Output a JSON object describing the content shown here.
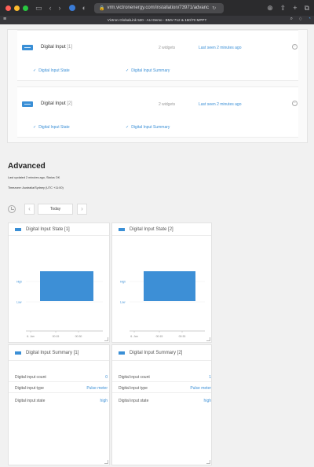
{
  "browser": {
    "url": "vrm.victronenergy.com/installation/73971/advanc",
    "lock_icon": "lock-icon"
  },
  "header": {
    "title": "Victron GlobalLink 520 - AU Demo - BMV-712 & 150/70 MPPT"
  },
  "devices": [
    {
      "name": "Digital Input",
      "index": "[1]",
      "widgets": "2 widgets",
      "last_seen": "Last seen 2 minutes ago",
      "items": [
        "Digital Input State",
        "Digital Input Summary"
      ]
    },
    {
      "name": "Digital Input",
      "index": "[2]",
      "widgets": "2 widgets",
      "last_seen": "Last seen 2 minutes ago",
      "items": [
        "Digital Input State",
        "Digital Input Summary"
      ]
    }
  ],
  "advanced": {
    "title": "Advanced",
    "updated": "Last updated 2 minutes ago, Status OK",
    "timezone": "Timezone: Australia/Sydney (UTC +11:00)",
    "today_label": "Today",
    "prev_label": "‹",
    "next_label": "›"
  },
  "state_widgets": [
    {
      "title": "Digital Input State [1]"
    },
    {
      "title": "Digital Input State [2]"
    }
  ],
  "summary_widgets": [
    {
      "title": "Digital Input Summary [1]",
      "rows": [
        {
          "label": "Digital input count",
          "value": "0"
        },
        {
          "label": "Digital input type",
          "value": "Pulse meter"
        },
        {
          "label": "Digital input state",
          "value": "high"
        }
      ]
    },
    {
      "title": "Digital Input Summary [2]",
      "rows": [
        {
          "label": "Digital input count",
          "value": "1"
        },
        {
          "label": "Digital input type",
          "value": "Pulse meter"
        },
        {
          "label": "Digital input state",
          "value": "high"
        }
      ]
    }
  ],
  "chart_data": [
    {
      "type": "area",
      "yticks": [
        "High",
        "Low"
      ],
      "xticks": [
        "6. Jan",
        "00:15",
        "00:30"
      ],
      "series": [
        {
          "values": [
            1,
            1,
            1
          ]
        }
      ],
      "bar_color": "#3d8fd6"
    },
    {
      "type": "area",
      "yticks": [
        "High",
        "Low"
      ],
      "xticks": [
        "6. Jan",
        "00:15",
        "00:30"
      ],
      "series": [
        {
          "values": [
            1,
            1,
            1
          ]
        }
      ],
      "bar_color": "#3d8fd6"
    }
  ],
  "colors": {
    "accent": "#3a8fd6",
    "header_bg": "#36363a"
  }
}
